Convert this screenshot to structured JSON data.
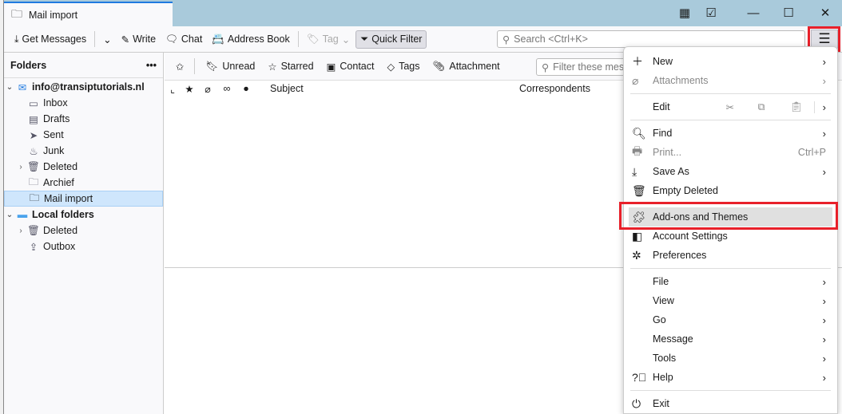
{
  "tab": {
    "title": "Mail import"
  },
  "toolbar": {
    "get_messages": "Get Messages",
    "write": "Write",
    "chat": "Chat",
    "address_book": "Address Book",
    "tag": "Tag",
    "quick_filter": "Quick Filter",
    "search_placeholder": "Search <Ctrl+K>"
  },
  "folders": {
    "header": "Folders",
    "account": "info@transiptutorials.nl",
    "items": [
      "Inbox",
      "Drafts",
      "Sent",
      "Junk",
      "Deleted",
      "Archief",
      "Mail import"
    ],
    "local": "Local folders",
    "local_items": [
      "Deleted",
      "Outbox"
    ],
    "selected": "Mail import"
  },
  "quickfilter": {
    "unread": "Unread",
    "starred": "Starred",
    "contact": "Contact",
    "tags": "Tags",
    "attachment": "Attachment",
    "filter_placeholder": "Filter these messages <Ctrl+Shift+K>"
  },
  "columns": {
    "subject": "Subject",
    "correspondents": "Correspondents"
  },
  "menu": {
    "new": "New",
    "attachments": "Attachments",
    "edit": "Edit",
    "find": "Find",
    "print": "Print...",
    "print_shortcut": "Ctrl+P",
    "save_as": "Save As",
    "empty_deleted": "Empty Deleted",
    "addons": "Add-ons and Themes",
    "account_settings": "Account Settings",
    "preferences": "Preferences",
    "file": "File",
    "view": "View",
    "go": "Go",
    "message": "Message",
    "tools": "Tools",
    "help": "Help",
    "exit": "Exit"
  },
  "colors": {
    "highlight": "#e8202a",
    "accent": "#1f7ae0",
    "titlebar": "#a9cadb",
    "selected": "#cfe6fc"
  }
}
